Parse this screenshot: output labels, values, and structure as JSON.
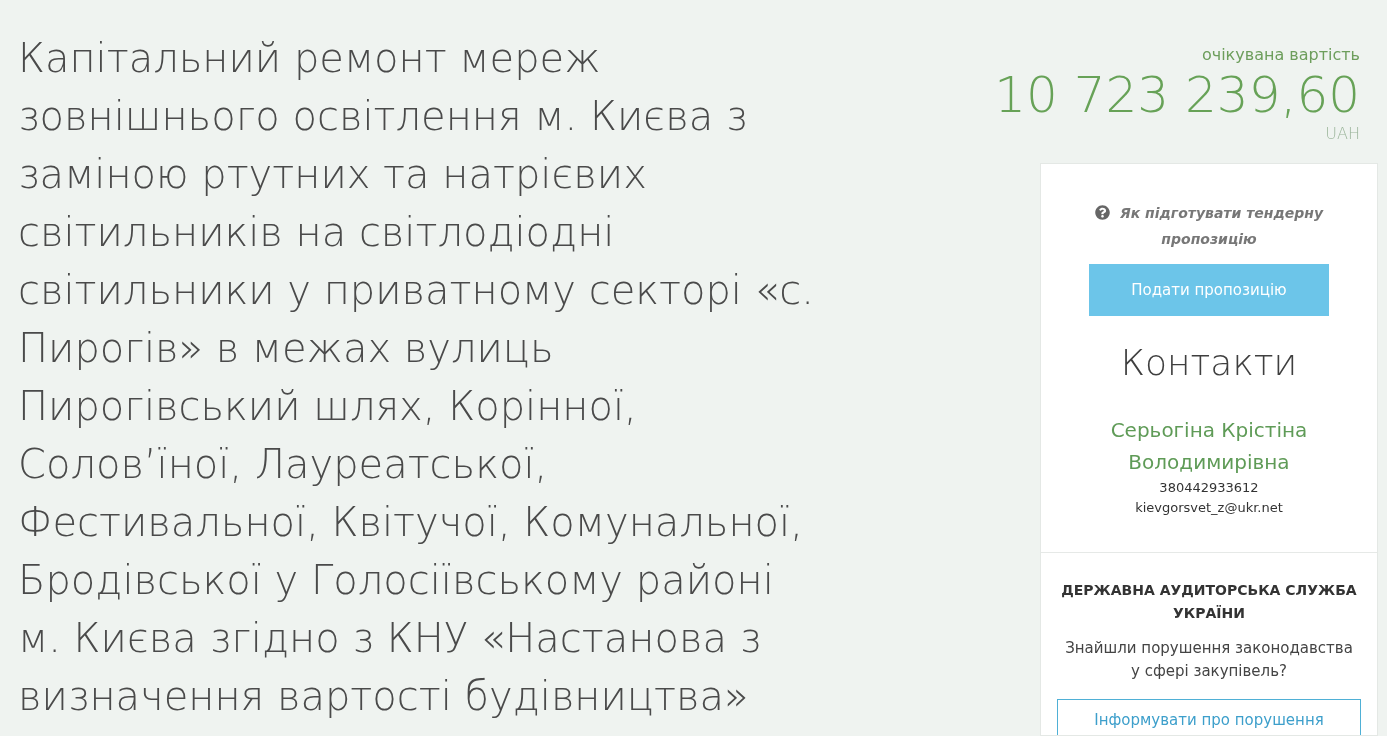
{
  "title": "Капітальний ремонт мереж зовнішнього освітлення м. Києва з заміною ртутних та натрієвих світильників на світлодіодні світильники у приватному секторі «с. Пирогів» в межах вулиць Пирогівський шлях, Корінної, Солов’їної, Лауреатської, Фестивальної, Квітучої, Комунальної, Бродівської у Голосіївському районі м. Києва згідно з КНУ «Настанова з визначення вартості будівництва»",
  "budget": {
    "label": "очікувана вартість",
    "amount": "10 723 239,60",
    "currency": "UAH"
  },
  "sidebar": {
    "help_link": "Як підготувати тендерну пропозицію",
    "submit_button": "Подати пропозицію",
    "contacts": {
      "heading": "Контакти",
      "name": "Серьогіна Крістіна Володимирівна",
      "phone": "380442933612",
      "email": "kievgorsvet_z@ukr.net"
    },
    "audit": {
      "heading": "ДЕРЖАВНА АУДИТОРСЬКА СЛУЖБА УКРАЇНИ",
      "question": "Знайшли порушення законодавства у сфері закупівель?",
      "report_button": "Інформувати про порушення"
    }
  }
}
